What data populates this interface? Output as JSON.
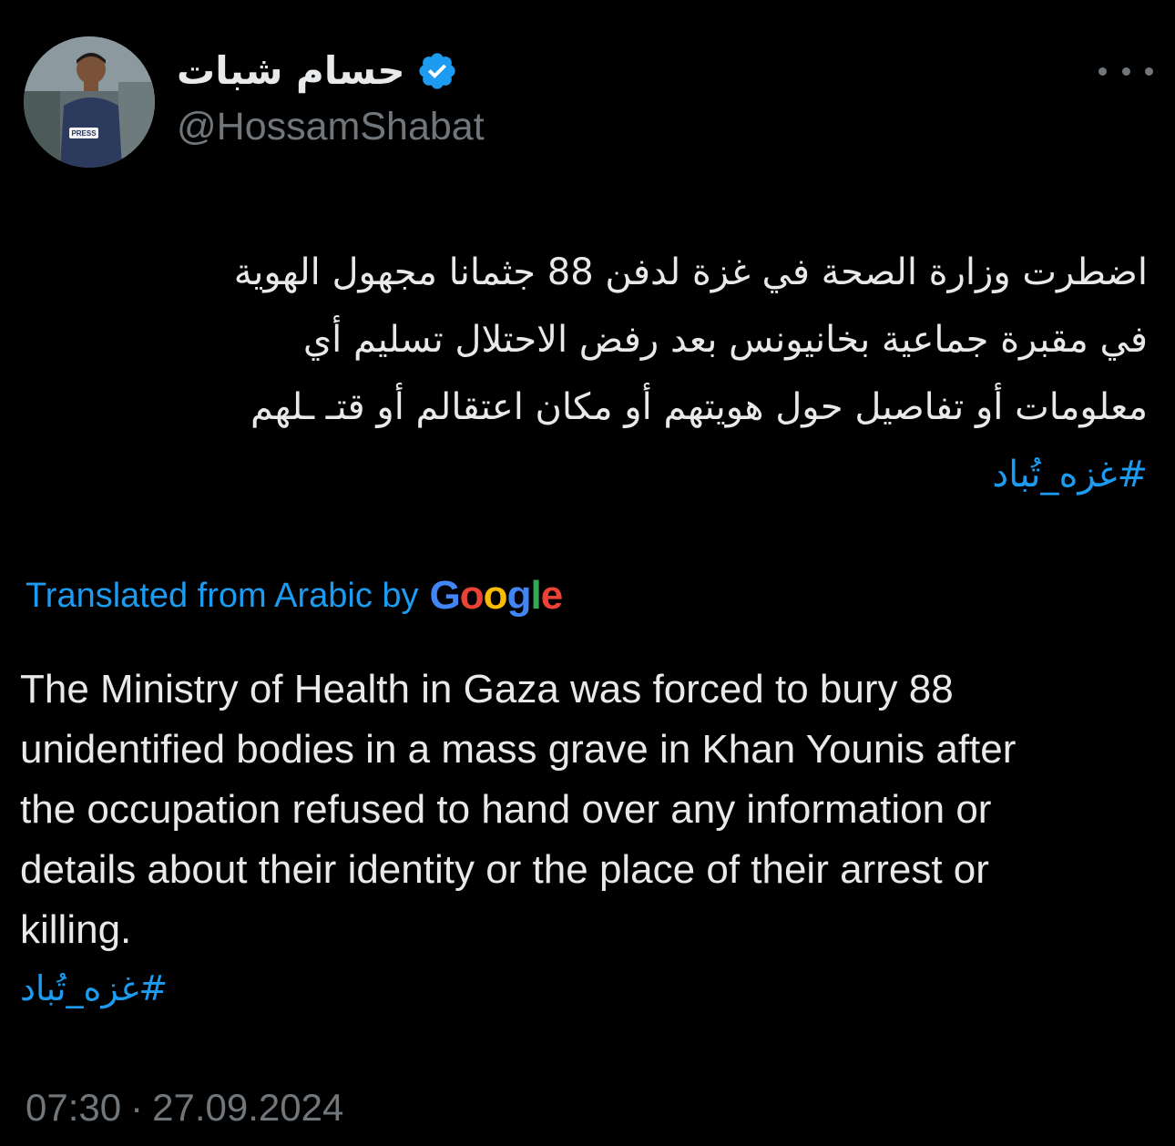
{
  "author": {
    "display_name": "حسام شبات",
    "handle": "@HossamShabat",
    "verified": true
  },
  "tweet": {
    "arabic_lines": [
      "اضطرت وزارة الصحة في غزة لدفن 88 جثمانا مجهول الهوية",
      "في مقبرة جماعية بخانيونس بعد رفض الاحتلال تسليم أي",
      "معلومات أو تفاصيل حول هويتهم أو مكان اعتقالم أو قتـ ـلهم"
    ],
    "arabic_hashtag": "#غزه_تُباد",
    "translation_label": "Translated from Arabic by",
    "translation_provider": "Google",
    "english_lines": [
      "The Ministry of Health in Gaza was forced to bury 88",
      "unidentified bodies in a mass grave in Khan Younis after",
      "the occupation refused to hand over any information or",
      "details about their identity or the place of their arrest or",
      "killing."
    ],
    "english_hashtag": "#غزه_تُباد",
    "time": "07:30",
    "separator": "·",
    "date": "27.09.2024"
  },
  "icons": {
    "verified": "verified-badge-icon",
    "more": "more-options-icon"
  },
  "colors": {
    "background": "#000000",
    "text": "#e7e9ea",
    "secondary": "#71767b",
    "link": "#1d9bf0",
    "google_blue": "#4285F4",
    "google_red": "#EA4335",
    "google_yellow": "#FBBC05",
    "google_green": "#34A853"
  }
}
